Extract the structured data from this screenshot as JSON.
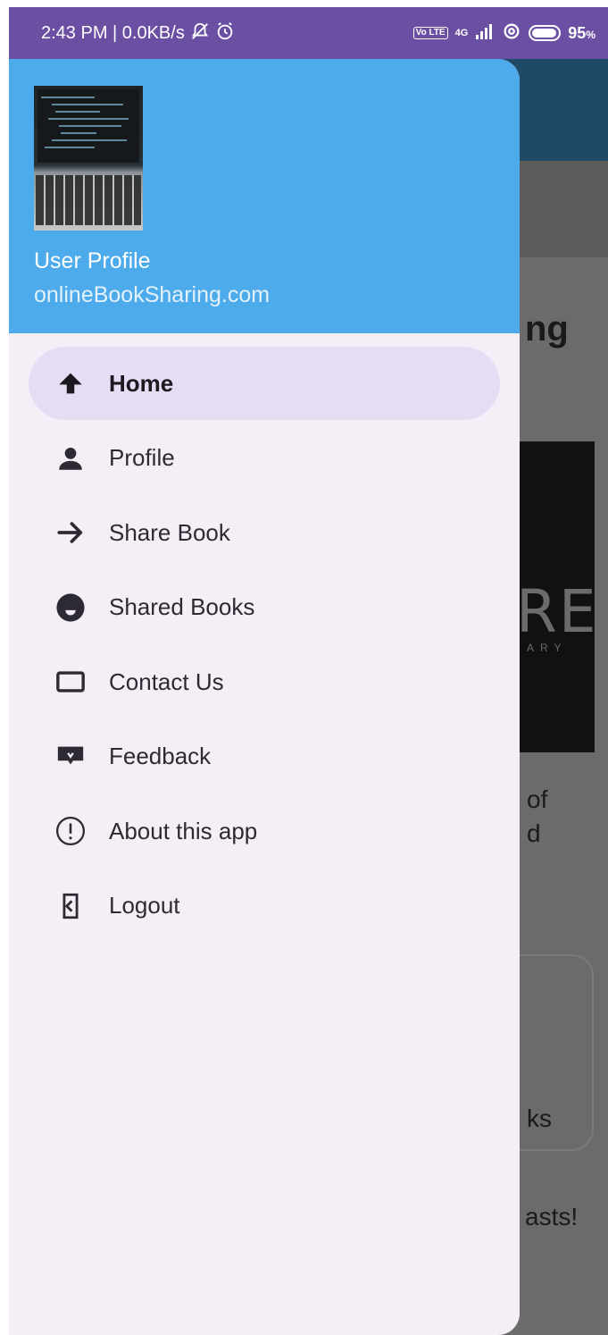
{
  "status_bar": {
    "time_speed": "2:43 PM | 0.0KB/s",
    "network": "4G",
    "lte": "Vo LTE",
    "battery": "95",
    "battery_unit": "%"
  },
  "drawer": {
    "header": {
      "name": "User Profile",
      "email": "onlineBookSharing.com"
    },
    "items": [
      {
        "label": "Home",
        "icon": "home-arrow-icon",
        "active": true
      },
      {
        "label": "Profile",
        "icon": "person-icon",
        "active": false
      },
      {
        "label": "Share Book",
        "icon": "arrow-right-icon",
        "active": false
      },
      {
        "label": "Shared Books",
        "icon": "circle-smile-icon",
        "active": false
      },
      {
        "label": "Contact Us",
        "icon": "rectangle-icon",
        "active": false
      },
      {
        "label": "Feedback",
        "icon": "feedback-icon",
        "active": false
      },
      {
        "label": "About this app",
        "icon": "info-circle-icon",
        "active": false
      },
      {
        "label": "Logout",
        "icon": "logout-icon",
        "active": false
      }
    ]
  },
  "background": {
    "title_fragment": "ng",
    "image_text": "RE",
    "image_subtext": "ARY",
    "text_line1": "of",
    "text_line2": "d",
    "card_text": "ks",
    "text_line3": "asts!"
  },
  "colors": {
    "status_bar": "#6a4fa3",
    "drawer_header": "#4dabec",
    "drawer_bg": "#f4eff7",
    "active_item": "#e6dcf4"
  }
}
